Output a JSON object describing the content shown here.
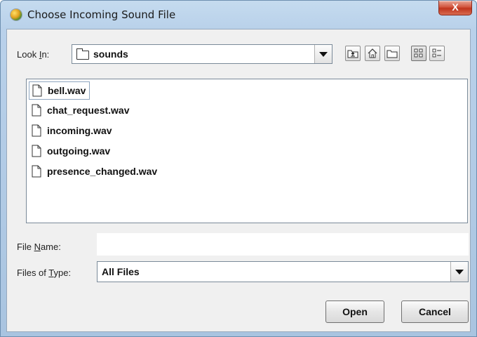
{
  "window": {
    "title": "Choose Incoming Sound File",
    "close_label": "X"
  },
  "look_in": {
    "label_pre": "Look ",
    "label_mnemonic": "I",
    "label_post": "n:",
    "value": "sounds"
  },
  "toolbar": {
    "buttons": [
      {
        "name": "up-one-level-icon"
      },
      {
        "name": "home-icon"
      },
      {
        "name": "new-folder-icon"
      },
      {
        "name": "list-view-icon"
      },
      {
        "name": "details-view-icon"
      }
    ]
  },
  "files": [
    {
      "name": "bell.wav",
      "focused": true
    },
    {
      "name": "chat_request.wav"
    },
    {
      "name": "incoming.wav"
    },
    {
      "name": "outgoing.wav"
    },
    {
      "name": "presence_changed.wav"
    }
  ],
  "file_name": {
    "label_pre": "File ",
    "label_mnemonic": "N",
    "label_post": "ame:",
    "value": "",
    "placeholder": ""
  },
  "file_type": {
    "label_pre": "Files of ",
    "label_mnemonic": "T",
    "label_post": "ype:",
    "value": "All Files"
  },
  "buttons": {
    "open": "Open",
    "cancel": "Cancel"
  },
  "colors": {
    "title_bar": "#b9d1ea",
    "close_button": "#c0351d",
    "dialog_bg": "#f0f0f0"
  }
}
